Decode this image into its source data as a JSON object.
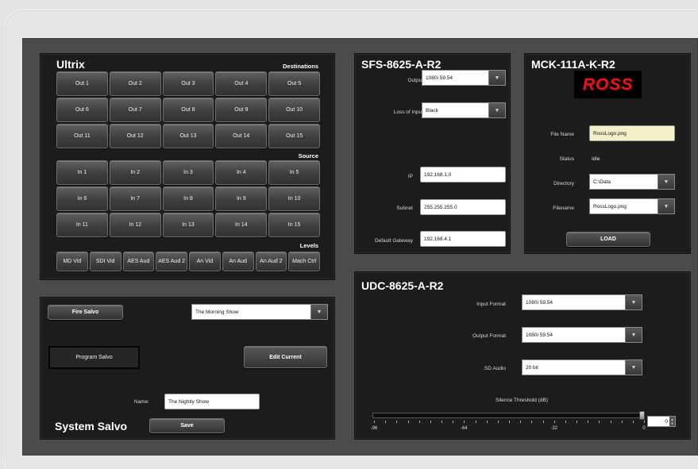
{
  "ultrix": {
    "title": "Ultrix",
    "destinations_label": "Destinations",
    "destinations": [
      "Out 1",
      "Out 2",
      "Out 3",
      "Out 4",
      "Out 5",
      "Out 6",
      "Out 7",
      "Out 8",
      "Out 9",
      "Out 10",
      "Out 11",
      "Out 12",
      "Out 13",
      "Out 14",
      "Out 15"
    ],
    "source_label": "Source",
    "sources": [
      "In 1",
      "In 2",
      "In 3",
      "In 4",
      "In 5",
      "In 6",
      "In 7",
      "In 8",
      "In 9",
      "In 10",
      "In 11",
      "In 12",
      "In 13",
      "In 14",
      "In 15"
    ],
    "levels_label": "Levels",
    "levels": [
      "MD Vid",
      "SDI Vid",
      "AES Aud",
      "AES Aud 2",
      "An Vid",
      "An Aud",
      "An Aud 2",
      "Mach Ctrl"
    ]
  },
  "salvo": {
    "fire_label": "Fire Salvo",
    "show_selected": "The Morning Show",
    "program_label": "Program Salvo",
    "edit_label": "Edit Current",
    "name_label": "Name:",
    "name_value": "The Nightly Show",
    "title": "System Salvo",
    "save_label": "Save"
  },
  "sfs": {
    "title": "SFS-8625-A-R2",
    "output_label": "Output",
    "output_value": "1080i 59.54",
    "loss_label": "Loss of Input",
    "loss_value": "Black",
    "ip_label": "IP",
    "ip_value": "192.168.1.0",
    "subnet_label": "Subnet",
    "subnet_value": "255.255.255.0",
    "gateway_label": "Default Gateway",
    "gateway_value": "192.168.4.1"
  },
  "mck": {
    "title": "MCK-111A-K-R2",
    "logo_text": "ROSS",
    "file_name_label": "File Name",
    "file_name_value": "RossLogo.png",
    "status_label": "Status",
    "status_value": "Idle",
    "directory_label": "Directory",
    "directory_value": "C:\\Data",
    "filename_label": "Filename",
    "filename_value": "RossLogo.png",
    "load_label": "LOAD"
  },
  "udc": {
    "title": "UDC-8625-A-R2",
    "input_format_label": "Input Format",
    "input_format_value": "1080i 59.54",
    "output_format_label": "Output Format",
    "output_format_value": "1080i 59.54",
    "sd_audio_label": "SD Audio",
    "sd_audio_value": "20 bit",
    "silence_label": "Silence Threshold (dB)",
    "silence_value": "0",
    "silence_level": 0,
    "scale_labels": [
      "-96",
      "-64",
      "-32",
      "0"
    ]
  },
  "icons": {
    "dropdown": "chevron-down-icon",
    "window_controls": "circle-icon"
  },
  "colors": {
    "panel_bg": "#1c1c1c",
    "app_bg": "#4b4b4b",
    "logo_red": "#e0141b"
  }
}
